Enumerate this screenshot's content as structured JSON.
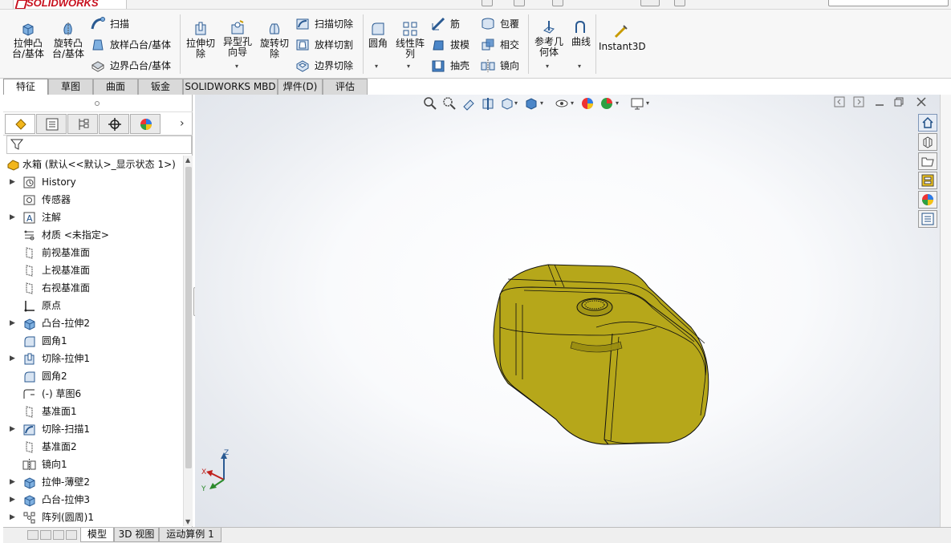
{
  "app": {
    "name": "SOLIDWORKS"
  },
  "ribbon": {
    "extrude_boss": "拉伸凸\n台/基体",
    "revolve_boss": "旋转凸\n台/基体",
    "sweep": "扫描",
    "loft_boss": "放样凸台/基体",
    "boundary_boss": "边界凸台/基体",
    "extrude_cut": "拉伸切\n除",
    "hole_wizard": "异型孔\n向导",
    "revolve_cut": "旋转切\n除",
    "swept_cut": "扫描切除",
    "lofted_cut": "放样切割",
    "boundary_cut": "边界切除",
    "fillet": "圆角",
    "linear_pattern": "线性阵\n列",
    "rib": "筋",
    "draft": "拔模",
    "shell": "抽壳",
    "wrap": "包覆",
    "intersect": "相交",
    "mirror": "镜向",
    "ref_geometry": "参考几\n何体",
    "curves": "曲线",
    "instant3d": "Instant3D"
  },
  "tabs": [
    "特征",
    "草图",
    "曲面",
    "钣金",
    "SOLIDWORKS MBD",
    "焊件(D)",
    "评估"
  ],
  "active_tab": "特征",
  "tree": {
    "root": "水箱 (默认<<默认>_显示状态 1>)",
    "items": [
      {
        "label": "History",
        "icon": "history-icon",
        "expand": true
      },
      {
        "label": "传感器",
        "icon": "sensor-icon",
        "expand": false
      },
      {
        "label": "注解",
        "icon": "annotation-icon",
        "expand": true
      },
      {
        "label": "材质 <未指定>",
        "icon": "material-icon",
        "expand": false
      },
      {
        "label": "前视基准面",
        "icon": "plane-icon",
        "expand": false
      },
      {
        "label": "上视基准面",
        "icon": "plane-icon",
        "expand": false
      },
      {
        "label": "右视基准面",
        "icon": "plane-icon",
        "expand": false
      },
      {
        "label": "原点",
        "icon": "origin-icon",
        "expand": false
      },
      {
        "label": "凸台-拉伸2",
        "icon": "extrude-icon",
        "expand": true
      },
      {
        "label": "圆角1",
        "icon": "fillet-icon",
        "expand": false
      },
      {
        "label": "切除-拉伸1",
        "icon": "cut-extrude-icon",
        "expand": true
      },
      {
        "label": "圆角2",
        "icon": "fillet-icon",
        "expand": false
      },
      {
        "label": "(-) 草图6",
        "icon": "sketch-icon",
        "expand": false
      },
      {
        "label": "基准面1",
        "icon": "plane-icon",
        "expand": false
      },
      {
        "label": "切除-扫描1",
        "icon": "swept-cut-icon",
        "expand": true
      },
      {
        "label": "基准面2",
        "icon": "plane-icon",
        "expand": false
      },
      {
        "label": "镜向1",
        "icon": "mirror-icon",
        "expand": false
      },
      {
        "label": "拉伸-薄壁2",
        "icon": "extrude-icon",
        "expand": true
      },
      {
        "label": "凸台-拉伸3",
        "icon": "extrude-icon",
        "expand": true
      },
      {
        "label": "阵列(圆周)1",
        "icon": "pattern-icon",
        "expand": true
      }
    ]
  },
  "bottom_tabs": [
    "模型",
    "3D 视图",
    "运动算例 1"
  ],
  "active_bottom_tab": "模型",
  "triad": {
    "x": "X",
    "y": "Y",
    "z": "Z"
  },
  "colors": {
    "model": "#b6a71a",
    "model_dark": "#8a7d0e",
    "accent": "#2c6fbf"
  }
}
